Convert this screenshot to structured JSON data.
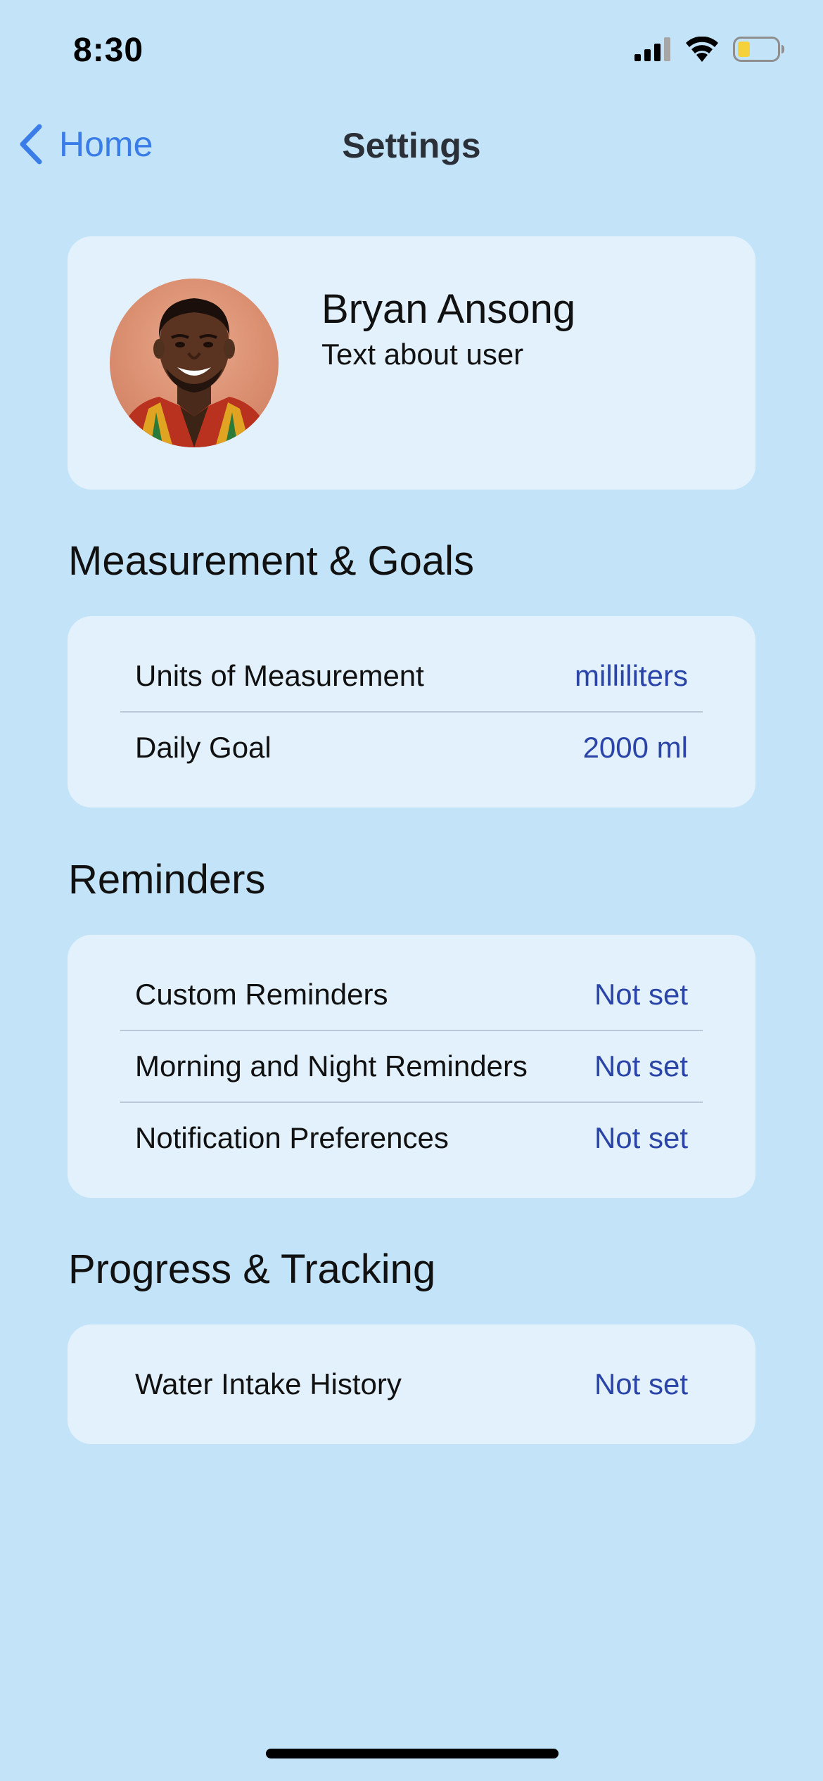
{
  "status_bar": {
    "time": "8:30",
    "battery_color": "#f5d13b"
  },
  "nav": {
    "back_label": "Home",
    "title": "Settings"
  },
  "profile": {
    "name": "Bryan Ansong",
    "subtitle": "Text about user"
  },
  "sections": [
    {
      "title": "Measurement & Goals",
      "rows": [
        {
          "label": "Units of Measurement",
          "value": "milliliters"
        },
        {
          "label": "Daily Goal",
          "value": "2000 ml"
        }
      ]
    },
    {
      "title": "Reminders",
      "rows": [
        {
          "label": "Custom Reminders",
          "value": "Not set"
        },
        {
          "label": "Morning and Night Reminders",
          "value": "Not set"
        },
        {
          "label": "Notification Preferences",
          "value": "Not set"
        }
      ]
    },
    {
      "title": "Progress & Tracking",
      "rows": [
        {
          "label": "Water Intake History",
          "value": "Not set"
        }
      ]
    }
  ],
  "colors": {
    "background": "#c3e4f8",
    "card": "#e2f1fc",
    "accent": "#3a7de8",
    "value": "#2a44a8"
  }
}
